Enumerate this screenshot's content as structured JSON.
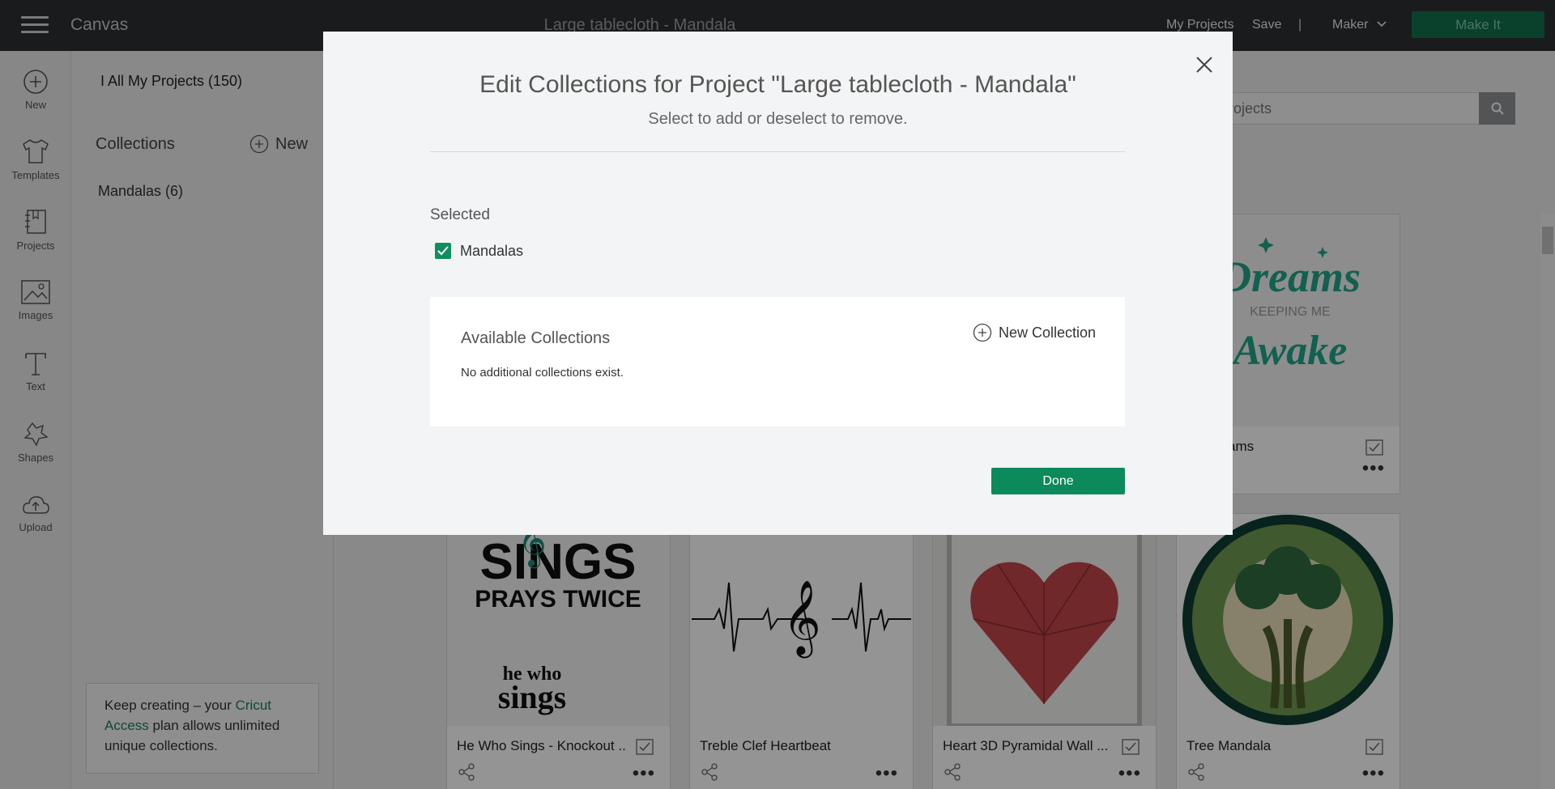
{
  "app": {
    "name": "Canvas",
    "project_title": "Large tablecloth - Mandala"
  },
  "topbar": {
    "my_projects": "My Projects",
    "save": "Save",
    "separator": "|",
    "machine": "Maker",
    "make_it": "Make It"
  },
  "leftnav": [
    {
      "label": "New",
      "icon": "plus-circle-icon"
    },
    {
      "label": "Templates",
      "icon": "tshirt-icon"
    },
    {
      "label": "Projects",
      "icon": "notebook-icon"
    },
    {
      "label": "Images",
      "icon": "image-icon"
    },
    {
      "label": "Text",
      "icon": "text-icon"
    },
    {
      "label": "Shapes",
      "icon": "shapes-icon"
    },
    {
      "label": "Upload",
      "icon": "cloud-upload-icon"
    }
  ],
  "sidebar": {
    "all_projects": "I All My Projects (150)",
    "collections_title": "Collections",
    "new_label": "New",
    "collections": [
      "Mandalas (6)"
    ],
    "promo": {
      "prefix": "Keep creating – your ",
      "link": "Cricut Access",
      "suffix": " plan allows unlimited unique collections."
    }
  },
  "main": {
    "search_placeholder": "Search in My Projects",
    "cards": [
      {
        "name": "A Million Dreams",
        "visible_name": "on Dreams"
      },
      {
        "name": "He Who Sings - Knockout ..."
      },
      {
        "name": "Treble Clef Heartbeat"
      },
      {
        "name": "Heart 3D Pyramidal Wall ..."
      },
      {
        "name": "Tree Mandala"
      }
    ]
  },
  "modal": {
    "title": "Edit Collections for Project \"Large tablecloth - Mandala\"",
    "subtitle": "Select to add or deselect to remove.",
    "selected_title": "Selected",
    "selected": [
      {
        "label": "Mandalas",
        "checked": true
      }
    ],
    "available_title": "Available Collections",
    "available_empty": "No additional collections exist.",
    "new_collection": "New Collection",
    "done": "Done"
  },
  "colors": {
    "brand_green": "#0c8a5c",
    "topbar": "#2b2f33",
    "overlay": "rgba(0,0,0,0.42)"
  }
}
